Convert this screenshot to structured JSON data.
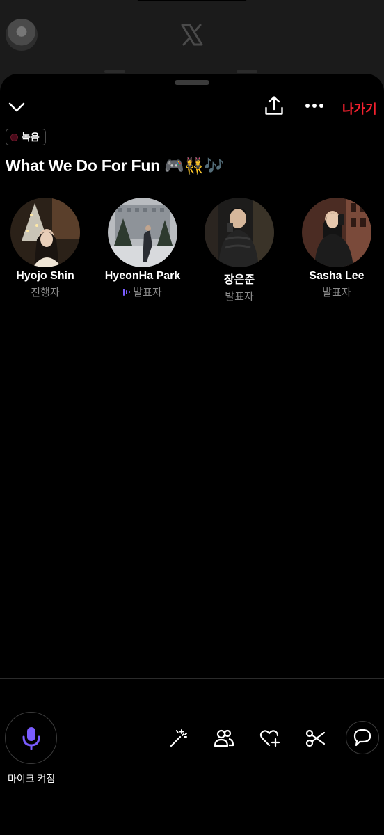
{
  "space": {
    "recording_label": "녹음",
    "title": "What We Do For Fun 🎮👯🎶",
    "leave_label": "나가기"
  },
  "speakers": [
    {
      "name": "Hyojo Shin",
      "role": "진행자",
      "speaking": false
    },
    {
      "name": "HyeonHa Park",
      "role": "발표자",
      "speaking": true
    },
    {
      "name": "장은준",
      "role": "발표자",
      "speaking": false
    },
    {
      "name": "Sasha Lee",
      "role": "발표자",
      "speaking": false
    }
  ],
  "controls": {
    "mic_label": "마이크 켜짐"
  },
  "icons": {
    "collapse": "chevron-down-icon",
    "share": "share-icon",
    "more": "more-icon",
    "mic": "microphone-icon",
    "effects": "magic-wand-icon",
    "people": "people-icon",
    "react": "heart-plus-icon",
    "clip": "scissors-icon",
    "chat": "chat-bubble-icon"
  },
  "colors": {
    "accent_purple": "#7a5cff",
    "leave_red": "#f4212e",
    "background": "#000000"
  }
}
